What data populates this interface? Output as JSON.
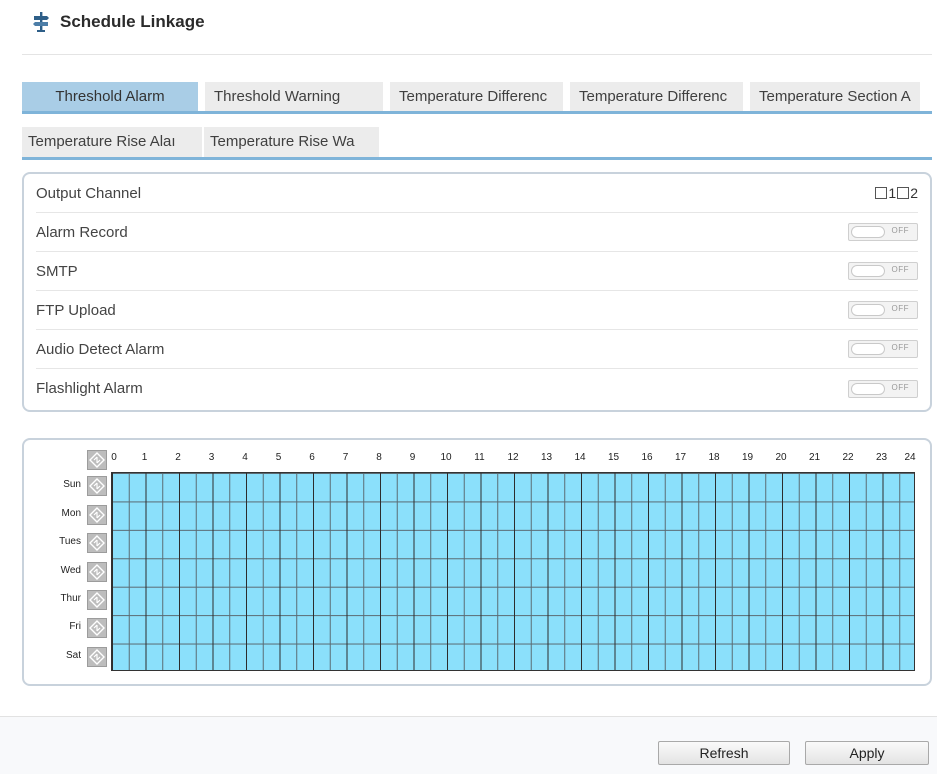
{
  "header": {
    "title": "Schedule Linkage",
    "icon": "signpost-icon"
  },
  "tabs": {
    "row1": [
      {
        "label": "Threshold Alarm",
        "active": true
      },
      {
        "label": "Threshold Warning",
        "active": false
      },
      {
        "label": "Temperature Differenc",
        "active": false
      },
      {
        "label": "Temperature Differenc",
        "active": false
      },
      {
        "label": "Temperature Section A",
        "active": false
      }
    ],
    "row2": [
      {
        "label": "Temperature Rise Alaı",
        "active": false
      },
      {
        "label": "Temperature Rise Wa",
        "active": false
      }
    ],
    "active_color": "#a9cde6",
    "underline_color": "#7fb4d9"
  },
  "options": {
    "output_channel": {
      "label": "Output Channel",
      "channels": [
        "1",
        "2"
      ]
    },
    "alarm_record": {
      "label": "Alarm Record",
      "state": "OFF"
    },
    "smtp": {
      "label": "SMTP",
      "state": "OFF"
    },
    "ftp_upload": {
      "label": "FTP Upload",
      "state": "OFF"
    },
    "audio_detect_alarm": {
      "label": "Audio Detect Alarm",
      "state": "OFF"
    },
    "flashlight_alarm": {
      "label": "Flashlight Alarm",
      "state": "OFF"
    }
  },
  "schedule": {
    "hours": [
      "0",
      "1",
      "2",
      "3",
      "4",
      "5",
      "6",
      "7",
      "8",
      "9",
      "10",
      "11",
      "12",
      "13",
      "14",
      "15",
      "16",
      "17",
      "18",
      "19",
      "20",
      "21",
      "22",
      "23",
      "24"
    ],
    "days": [
      "Sun",
      "Mon",
      "Tues",
      "Wed",
      "Thur",
      "Fri",
      "Sat"
    ],
    "fill_color": "#8be0fb",
    "toggle_icon": "invert-selection-icon"
  },
  "footer": {
    "refresh_label": "Refresh",
    "apply_label": "Apply"
  }
}
